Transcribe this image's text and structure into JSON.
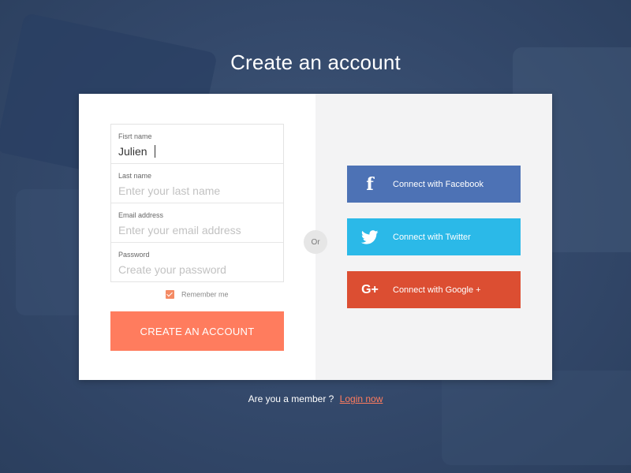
{
  "page": {
    "title": "Create an account"
  },
  "form": {
    "first_name": {
      "label": "Fisrt name",
      "value": "Julien",
      "placeholder": ""
    },
    "last_name": {
      "label": "Last name",
      "value": "",
      "placeholder": "Enter your last name"
    },
    "email": {
      "label": "Email address",
      "value": "",
      "placeholder": "Enter your email address"
    },
    "password": {
      "label": "Password",
      "value": "",
      "placeholder": "Create your password"
    },
    "remember": {
      "label": "Remember me",
      "checked": true
    },
    "submit_label": "CREATE AN ACCOUNT"
  },
  "divider": {
    "label": "Or"
  },
  "social": {
    "facebook": {
      "label": "Connect with Facebook",
      "icon": "facebook-icon",
      "glyph": "f",
      "color": "#4d72b5"
    },
    "twitter": {
      "label": "Connect with Twitter",
      "icon": "twitter-icon",
      "color": "#2bb9e8"
    },
    "google": {
      "label": "Connect with Google +",
      "icon": "google-plus-icon",
      "glyph": "G+",
      "color": "#dc4e32"
    }
  },
  "footer": {
    "prompt": "Are you a member ?",
    "login_label": "Login now"
  },
  "colors": {
    "accent": "#ff7c5e",
    "background": "#35496a",
    "panel": "#f3f3f4"
  }
}
